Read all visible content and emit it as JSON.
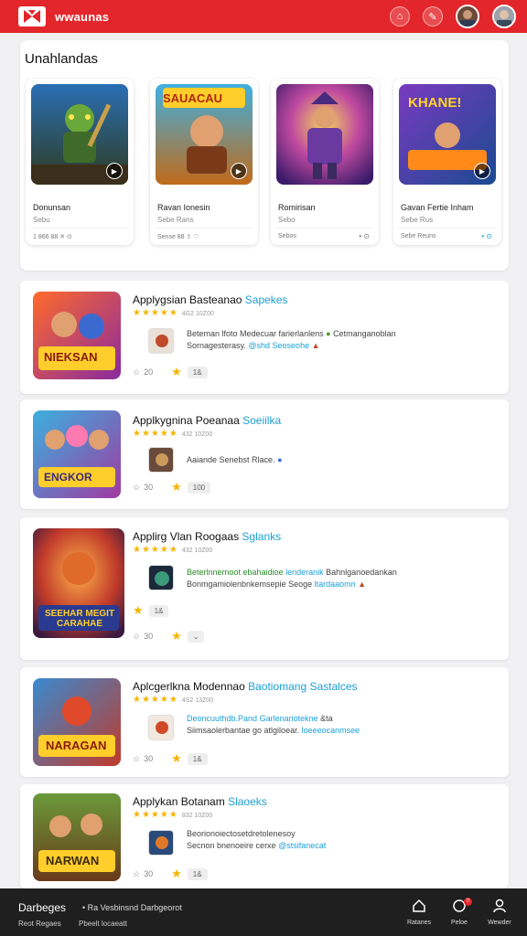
{
  "header": {
    "brand": "wwaunas",
    "icons": [
      "home-icon",
      "rocket-icon",
      "user-avatar",
      "profile-avatar"
    ]
  },
  "featured": {
    "title": "Unahlandas",
    "cards": [
      {
        "name": "Donunsan",
        "sub": "Sebu",
        "meta": "1 866   88   ✕ ⊙",
        "art_text": ""
      },
      {
        "name": "Ravan Ionesin",
        "sub": "Sebe Rans",
        "meta": "Sense   88   ⇧ ♡",
        "art_text": "SAUACAU"
      },
      {
        "name": "Romirisan",
        "sub": "Sebo",
        "meta": "Sebos",
        "art_text": ""
      },
      {
        "name": "Gavan Fertie Inham",
        "sub": "Sebe Rus",
        "meta": "Sebe Reuns",
        "art_text": "KHANE!"
      }
    ]
  },
  "list": [
    {
      "title": "Applygsian Basteanao",
      "tag": "Sapekes",
      "stars": "★★★★★",
      "count": "4G2 10Z00",
      "desc1": "Beteman lfoto Medecuar farierlanlens",
      "desc1b": "Cetmanganoblan",
      "desc2": "Sornagesterasy.",
      "desc2b": "@shd Seoseohe",
      "thumbs": "20",
      "chip": "1&",
      "art_text": "NIEKSAN"
    },
    {
      "title": "Applkygnina Poeanaa",
      "tag": "Soeiilka",
      "stars": "★★★★★",
      "count": "432 10Z00",
      "desc1": "Aaiande Senebst Rlace.",
      "desc1b": "",
      "desc2": "",
      "desc2b": "",
      "thumbs": "30",
      "chip": "100",
      "art_text": "ENGKOR"
    },
    {
      "title": "Applirg Vlan Roogaas",
      "tag": "Sglanks",
      "stars": "★★★★★",
      "count": "432 10Z00",
      "desc1": "Beterlnnernoot ebahaidioe",
      "desc1b": "lenderanik",
      "desc1c": "Bahnlganoedankan",
      "desc2": "Bonmgamiolenbnkemsepie Seoge",
      "desc2b": "ltardaaomn",
      "thumbs": "30",
      "chip": "⌄",
      "art_text": "SEEHAR MEGIT CARAHAE"
    },
    {
      "title": "Aplcgerlkna Modennao",
      "tag": "Baotiomang",
      "tag2": "Sastalces",
      "stars": "★★★★★",
      "count": "4S2 13Z00",
      "desc1": "Deoncuuthdb.Pand Garlenariotekne",
      "desc1b": "&ta",
      "desc2": "Siimsaolerbantae go atlgiloear.",
      "desc2b": "loeeeocanmsee",
      "thumbs": "30",
      "chip": "1&",
      "art_text": "NARAGAN"
    },
    {
      "title": "Applykan Botanam",
      "tag": "Slaoeks",
      "stars": "★★★★★",
      "count": "832 10Z00",
      "desc1": "Beorionoiectosetdretolenesoy",
      "desc1b": "",
      "desc2": "Secnon bnenoeire cerxe",
      "desc2b": "@stsifanecat",
      "thumbs": "30",
      "chip": "1&",
      "art_text": "NARWAN"
    }
  ],
  "footer": {
    "title": "Darbeges",
    "sub": "• Ra Vesbinsnd Darbgeorot",
    "link1": "Reot Regaes",
    "link2": "Pbeelt locaeatt",
    "nav": [
      {
        "label": "Ratanes",
        "icon": "home-icon"
      },
      {
        "label": "Peloe",
        "icon": "notification-icon",
        "badge": "!!"
      },
      {
        "label": "Wewder",
        "icon": "user-icon"
      }
    ]
  },
  "colors": {
    "brand": "#e3262b",
    "accent": "#1b9fd6",
    "star": "#f6b400",
    "footer": "#1f1f1f"
  }
}
